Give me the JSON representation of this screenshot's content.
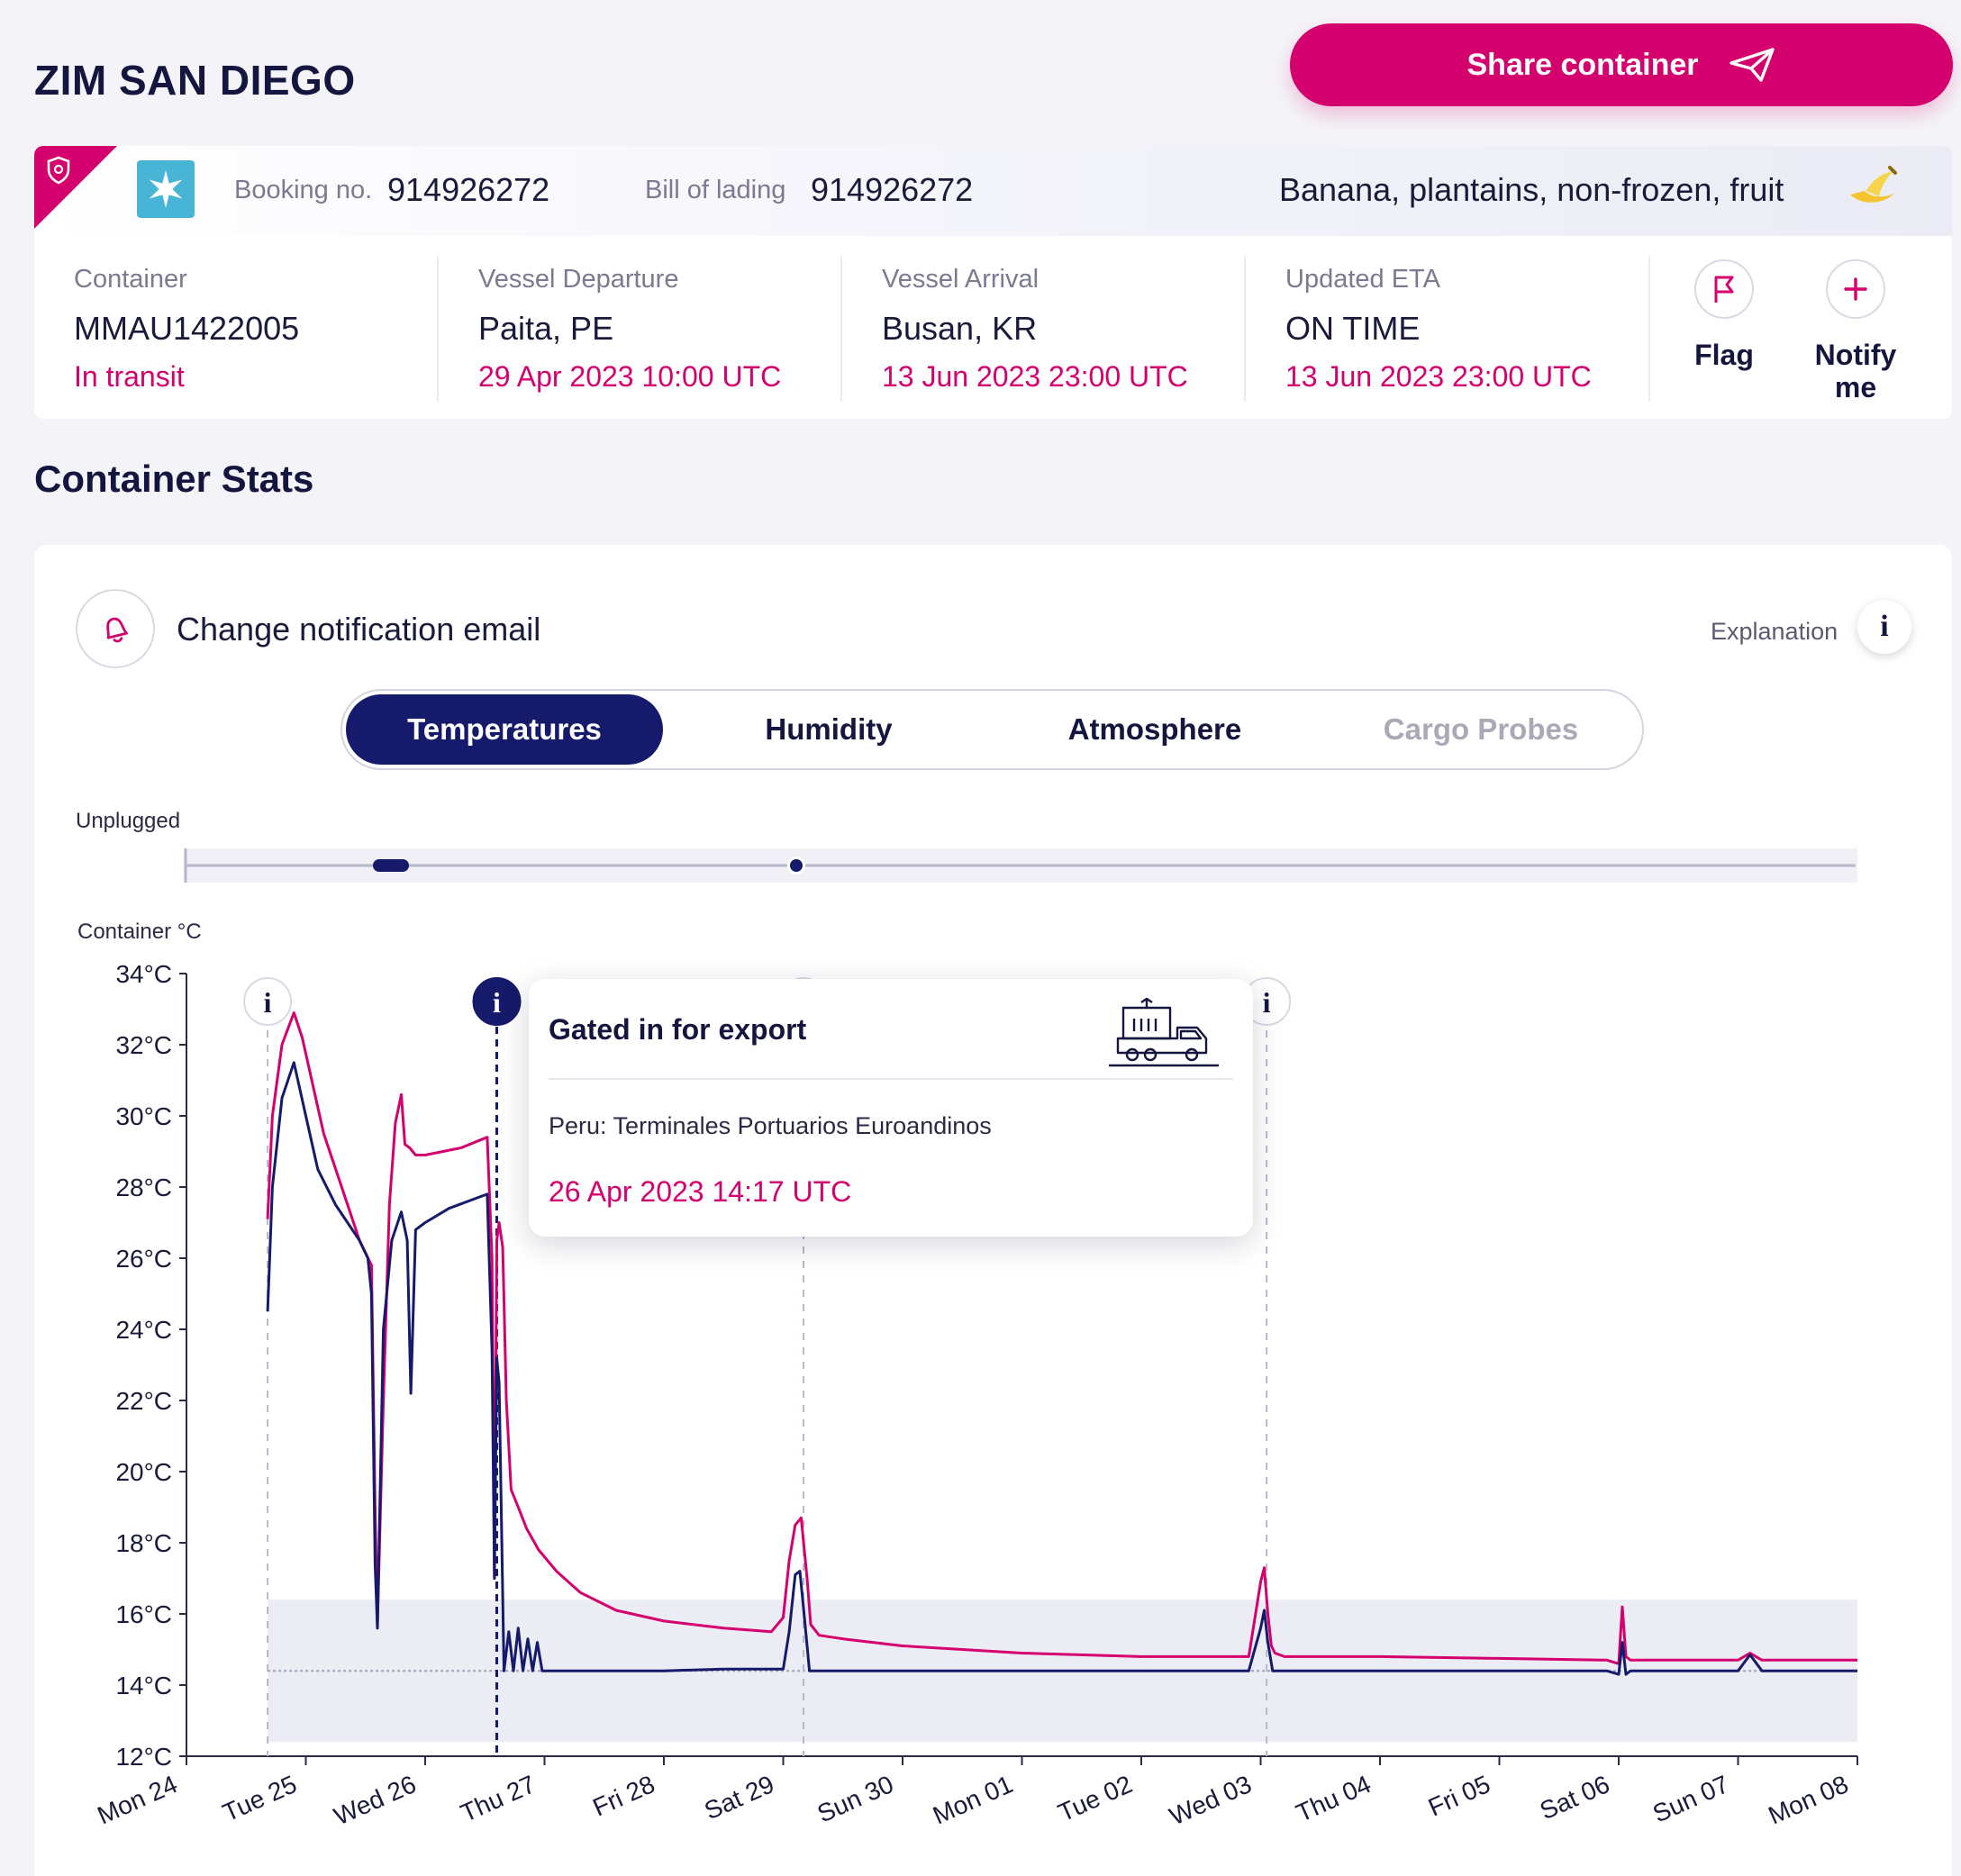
{
  "header": {
    "title": "ZIM SAN DIEGO",
    "share_label": "Share container"
  },
  "booking": {
    "booking_label": "Booking no.",
    "booking_value": "914926272",
    "bol_label": "Bill of lading",
    "bol_value": "914926272",
    "commodity": "Banana, plantains, non-frozen, fruit"
  },
  "details": {
    "container": {
      "label": "Container",
      "value": "MMAU1422005",
      "status": "In transit"
    },
    "departure": {
      "label": "Vessel Departure",
      "value": "Paita, PE",
      "time": "29 Apr 2023 10:00 UTC"
    },
    "arrival": {
      "label": "Vessel Arrival",
      "value": "Busan, KR",
      "time": "13 Jun 2023 23:00 UTC"
    },
    "eta": {
      "label": "Updated ETA",
      "value": "ON TIME",
      "time": "13 Jun 2023 23:00 UTC"
    },
    "flag_label": "Flag",
    "notify_label_1": "Notify",
    "notify_label_2": "me"
  },
  "stats": {
    "title": "Container Stats",
    "notification_label": "Change notification email",
    "explanation_label": "Explanation",
    "tabs": [
      "Temperatures",
      "Humidity",
      "Atmosphere",
      "Cargo Probes"
    ],
    "active_tab": "Temperatures",
    "unplugged_label": "Unplugged"
  },
  "tooltip": {
    "title": "Gated in for export",
    "location": "Peru: Terminales Portuarios Euroandinos",
    "time": "26 Apr 2023 14:17 UTC"
  },
  "colors": {
    "accent": "#d4006e",
    "navy": "#161a6a",
    "setpoint_band": "#ececf5"
  },
  "chart_data": {
    "type": "line",
    "ylabel": "Container °C",
    "ylim": [
      12,
      34
    ],
    "yticks": [
      "12°C",
      "14°C",
      "16°C",
      "18°C",
      "20°C",
      "22°C",
      "24°C",
      "26°C",
      "28°C",
      "30°C",
      "32°C",
      "34°C"
    ],
    "xticks": [
      "Mon 24",
      "Tue 25",
      "Wed 26",
      "Thu 27",
      "Fri 28",
      "Sat 29",
      "Sun 30",
      "Mon 01",
      "Tue 02",
      "Wed 03",
      "Thu 04",
      "Fri 05",
      "Sat 06",
      "Sun 07",
      "Mon 08"
    ],
    "xlim_days": [
      0,
      14
    ],
    "setpoint": 14.4,
    "band": [
      12.4,
      16.4
    ],
    "event_markers_days": [
      0.68,
      2.6,
      5.17,
      9.05
    ],
    "series": [
      {
        "color": "#d4006e",
        "x": [
          0.68,
          0.72,
          0.8,
          0.9,
          0.97,
          1.05,
          1.15,
          1.3,
          1.45,
          1.55,
          1.58,
          1.6,
          1.65,
          1.7,
          1.75,
          1.8,
          1.83,
          1.87,
          1.92,
          2.0,
          2.3,
          2.52,
          2.56,
          2.58,
          2.6,
          2.62,
          2.65,
          2.68,
          2.72,
          2.78,
          2.85,
          2.95,
          3.1,
          3.3,
          3.6,
          4.0,
          4.5,
          4.9,
          5.0,
          5.05,
          5.1,
          5.15,
          5.2,
          5.23,
          5.3,
          5.5,
          6.0,
          6.5,
          7.0,
          8.0,
          8.9,
          9.0,
          9.03,
          9.06,
          9.09,
          9.12,
          9.2,
          10.0,
          11.0,
          11.9,
          12.0,
          12.03,
          12.06,
          12.1,
          12.5,
          12.8,
          13.0,
          13.1,
          13.2,
          13.5,
          14.0
        ],
        "y": [
          27.1,
          30.0,
          32.0,
          32.9,
          32.2,
          31.0,
          29.5,
          28.0,
          26.5,
          25.8,
          19.0,
          15.7,
          22.0,
          27.5,
          29.8,
          30.6,
          29.2,
          29.1,
          28.9,
          28.9,
          29.1,
          29.4,
          26.0,
          17.0,
          26.5,
          27.0,
          26.3,
          22.0,
          19.5,
          19.0,
          18.4,
          17.8,
          17.2,
          16.6,
          16.1,
          15.8,
          15.6,
          15.5,
          15.9,
          17.5,
          18.5,
          18.7,
          17.0,
          15.7,
          15.4,
          15.3,
          15.1,
          15.0,
          14.9,
          14.8,
          14.8,
          16.9,
          17.3,
          16.0,
          15.1,
          14.9,
          14.8,
          14.8,
          14.75,
          14.7,
          14.6,
          16.2,
          14.8,
          14.7,
          14.7,
          14.7,
          14.7,
          14.9,
          14.7,
          14.7,
          14.7
        ]
      },
      {
        "color": "#161a6a",
        "x": [
          0.68,
          0.72,
          0.8,
          0.9,
          1.0,
          1.1,
          1.25,
          1.45,
          1.52,
          1.55,
          1.58,
          1.6,
          1.65,
          1.72,
          1.8,
          1.85,
          1.88,
          1.92,
          2.0,
          2.2,
          2.52,
          2.56,
          2.58,
          2.6,
          2.62,
          2.66,
          2.7,
          2.74,
          2.78,
          2.82,
          2.86,
          2.9,
          2.94,
          2.98,
          3.02,
          3.1,
          3.5,
          4.0,
          4.5,
          5.0,
          5.05,
          5.1,
          5.14,
          5.18,
          5.22,
          5.3,
          6.0,
          7.0,
          8.9,
          9.0,
          9.03,
          9.06,
          9.1,
          9.2,
          10.0,
          11.0,
          11.9,
          12.0,
          12.03,
          12.06,
          12.1,
          12.5,
          13.0,
          13.1,
          13.2,
          13.5,
          14.0
        ],
        "y": [
          24.5,
          28.0,
          30.5,
          31.5,
          30.0,
          28.5,
          27.5,
          26.5,
          26.0,
          25.0,
          17.4,
          15.6,
          24.0,
          26.5,
          27.3,
          26.5,
          22.2,
          26.8,
          27.0,
          27.4,
          27.8,
          23.4,
          17.0,
          23.2,
          22.5,
          14.4,
          15.5,
          14.4,
          15.6,
          14.4,
          15.3,
          14.4,
          15.2,
          14.4,
          14.4,
          14.4,
          14.4,
          14.4,
          14.45,
          14.45,
          15.5,
          17.1,
          17.2,
          15.8,
          14.4,
          14.4,
          14.4,
          14.4,
          14.4,
          15.6,
          16.1,
          15.2,
          14.4,
          14.4,
          14.4,
          14.4,
          14.4,
          14.3,
          15.2,
          14.3,
          14.4,
          14.4,
          14.4,
          14.85,
          14.4,
          14.4,
          14.4
        ]
      }
    ]
  }
}
